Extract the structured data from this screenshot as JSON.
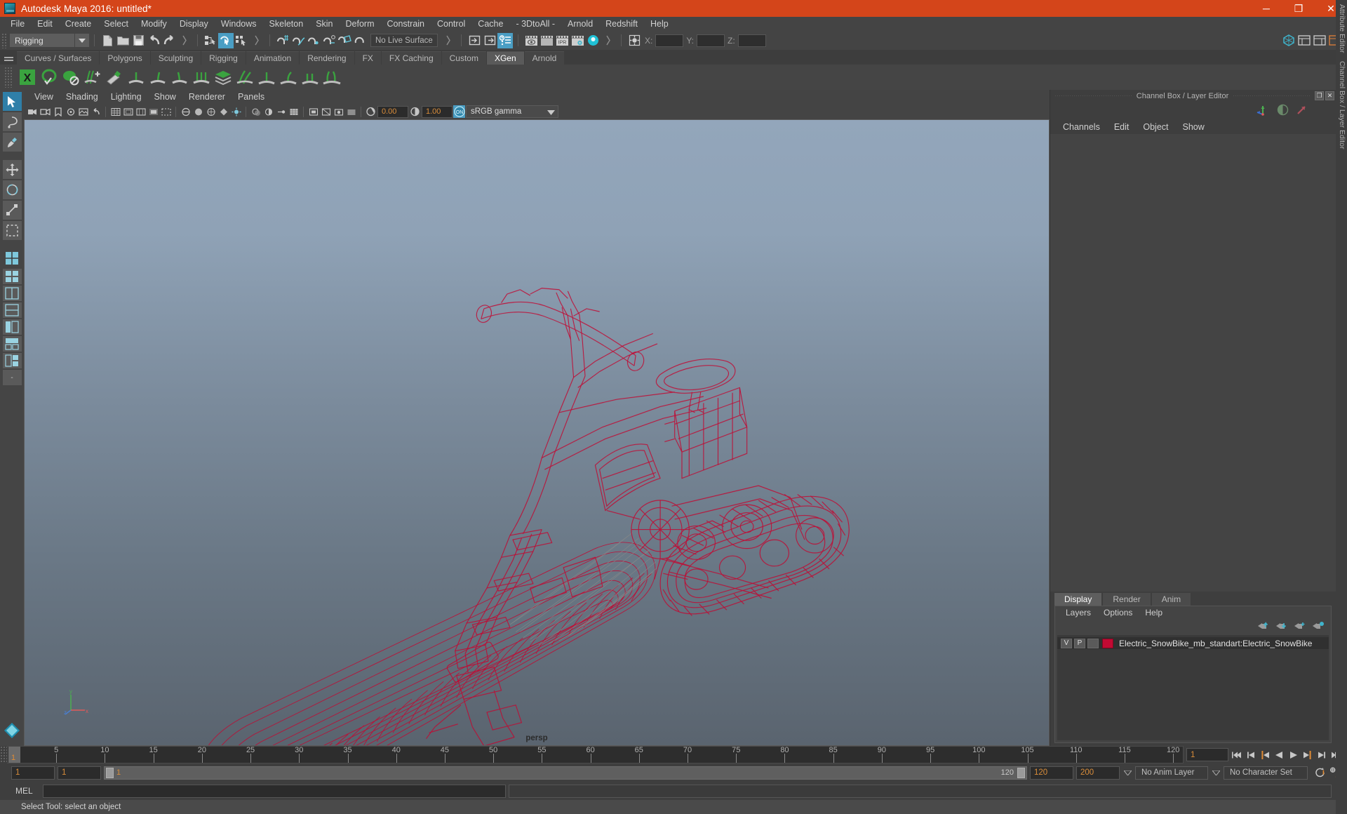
{
  "window": {
    "title": "Autodesk Maya 2016: untitled*",
    "minimize_label": "─",
    "maximize_label": "❐",
    "close_label": "✕",
    "accent_color": "#d4451a"
  },
  "menubar": {
    "items": [
      {
        "label": "File"
      },
      {
        "label": "Edit"
      },
      {
        "label": "Create"
      },
      {
        "label": "Select"
      },
      {
        "label": "Modify"
      },
      {
        "label": "Display"
      },
      {
        "label": "Windows"
      },
      {
        "label": "Skeleton"
      },
      {
        "label": "Skin"
      },
      {
        "label": "Deform"
      },
      {
        "label": "Constrain"
      },
      {
        "label": "Control"
      },
      {
        "label": "Cache"
      },
      {
        "label": "- 3DtoAll -"
      },
      {
        "label": "Arnold"
      },
      {
        "label": "Redshift"
      },
      {
        "label": "Help"
      }
    ]
  },
  "statusline": {
    "menu_set": "Rigging",
    "live_surface": "No Live Surface",
    "coord_labels": [
      "X:",
      "Y:",
      "Z:"
    ],
    "coord_values": [
      "",
      "",
      ""
    ],
    "icons": [
      "new-scene-icon",
      "open-scene-icon",
      "save-scene-icon",
      "undo-icon",
      "redo-icon",
      "select-hierarchy-icon",
      "select-object-icon",
      "select-component-icon",
      "snap-grid-icon",
      "snap-curve-icon",
      "snap-point-icon",
      "snap-projected-center-icon",
      "snap-view-plane-icon",
      "make-live-icon",
      "open-editor-left-icon",
      "open-editor-right-icon",
      "attribute-editor-icon",
      "render-view-icon",
      "render-region-icon",
      "ipr-render-icon",
      "render-settings-icon",
      "hypershade-icon",
      "selection-mask-icon"
    ]
  },
  "shelf": {
    "tabs": [
      {
        "label": "Curves / Surfaces",
        "selected": false
      },
      {
        "label": "Polygons",
        "selected": false
      },
      {
        "label": "Sculpting",
        "selected": false
      },
      {
        "label": "Rigging",
        "selected": false
      },
      {
        "label": "Animation",
        "selected": false
      },
      {
        "label": "Rendering",
        "selected": false
      },
      {
        "label": "FX",
        "selected": false
      },
      {
        "label": "FX Caching",
        "selected": false
      },
      {
        "label": "Custom",
        "selected": false
      },
      {
        "label": "XGen",
        "selected": true
      },
      {
        "label": "Arnold",
        "selected": false
      }
    ],
    "icons": [
      "xgen-window-icon",
      "xgen-preview-icon",
      "xgen-density-icon",
      "xgen-add-guide-icon",
      "xgen-sculpt-guide-icon",
      "xgen-lock-guide-icon",
      "xgen-groom-icon",
      "xgen-clump-icon",
      "xgen-noise-icon",
      "xgen-collection-icon",
      "xgen-description-icon",
      "xgen-grow-icon",
      "xgen-comb-icon",
      "xgen-cut-icon",
      "xgen-part-icon"
    ]
  },
  "toolbox": {
    "items": [
      {
        "name": "select-tool",
        "selected": true
      },
      {
        "name": "lasso-tool",
        "selected": false
      },
      {
        "name": "paint-select-tool",
        "selected": false
      },
      {
        "name": "move-tool",
        "selected": false
      },
      {
        "name": "rotate-tool",
        "selected": false
      },
      {
        "name": "scale-tool",
        "selected": false
      },
      {
        "name": "last-tool-used",
        "selected": false
      }
    ],
    "layout_label": "-"
  },
  "viewport": {
    "menus": [
      {
        "label": "View"
      },
      {
        "label": "Shading"
      },
      {
        "label": "Lighting"
      },
      {
        "label": "Show"
      },
      {
        "label": "Renderer"
      },
      {
        "label": "Panels"
      }
    ],
    "camera_label": "persp",
    "exposure_value": "0.00",
    "gamma_value": "1.00",
    "color_management": "sRGB gamma",
    "color_management_on": "ON",
    "toolbar_icons": [
      "select-camera-icon",
      "camera-attributes-icon",
      "bookmarks-icon",
      "image-plane-icon",
      "two-sided-lighting-icon",
      "shadows-icon",
      "wireframe-icon",
      "smooth-shade-all-icon",
      "smooth-shade-selected-icon",
      "flat-shade-icon",
      "bounding-box-icon",
      "xray-icon",
      "xray-joints-icon",
      "texture-icon",
      "use-all-lights-icon",
      "use-default-light-icon",
      "shadow-maps-icon",
      "ambient-occlusion-icon",
      "motion-blur-icon",
      "multisample-icon",
      "depth-of-field-icon",
      "isolate-select-icon",
      "grid-toggle-icon",
      "film-gate-icon",
      "resolution-gate-icon",
      "gate-mask-icon",
      "exposure-icon",
      "gamma-icon"
    ],
    "model_name": "Electric SnowBike wireframe",
    "wireframe_color": "#c20a33",
    "axis_labels": [
      "y",
      "z",
      "x"
    ]
  },
  "right_panel": {
    "title": "Channel Box / Layer Editor",
    "restore_label": "❐",
    "close_label": "✕",
    "channelbox_menus": [
      {
        "label": "Channels"
      },
      {
        "label": "Edit"
      },
      {
        "label": "Object"
      },
      {
        "label": "Show"
      }
    ],
    "vertical_tabs": [
      "Attribute Editor",
      "Channel Box / Layer Editor"
    ],
    "layer_tabs": [
      {
        "label": "Display",
        "selected": true
      },
      {
        "label": "Render",
        "selected": false
      },
      {
        "label": "Anim",
        "selected": false
      }
    ],
    "layer_menus": [
      {
        "label": "Layers"
      },
      {
        "label": "Options"
      },
      {
        "label": "Help"
      }
    ],
    "layer_buttons": [
      "move-layer-up-icon",
      "move-layer-down-icon",
      "new-layer-icon",
      "new-layer-from-selected-icon"
    ],
    "layers": [
      {
        "visibility": "V",
        "playback": "P",
        "state": "",
        "color": "#c20a33",
        "name": "Electric_SnowBike_mb_standart:Electric_SnowBike"
      }
    ]
  },
  "timeline": {
    "ticks": [
      5,
      10,
      15,
      20,
      25,
      30,
      35,
      40,
      45,
      50,
      55,
      60,
      65,
      70,
      75,
      80,
      85,
      90,
      95,
      100,
      105,
      110,
      115,
      120
    ],
    "current_frame": "1",
    "current_frame_field": "1",
    "playback_buttons": [
      "go-to-start-icon",
      "step-back-frame-icon",
      "step-back-key-icon",
      "play-backwards-icon",
      "play-forwards-icon",
      "step-forward-key-icon",
      "step-forward-frame-icon",
      "go-to-end-icon"
    ]
  },
  "range": {
    "anim_start": "1",
    "playback_start": "1",
    "slider_start_label": "1",
    "slider_end_label": "120",
    "playback_end": "120",
    "anim_end": "200",
    "anim_layer": "No Anim Layer",
    "character_set": "No Character Set",
    "auto_key_icon": "auto-keyframe-icon",
    "prefs_icon": "animation-preferences-icon"
  },
  "command_line": {
    "language": "MEL",
    "input_value": "",
    "output_value": ""
  },
  "help_line": {
    "text": "Select Tool: select an object"
  }
}
